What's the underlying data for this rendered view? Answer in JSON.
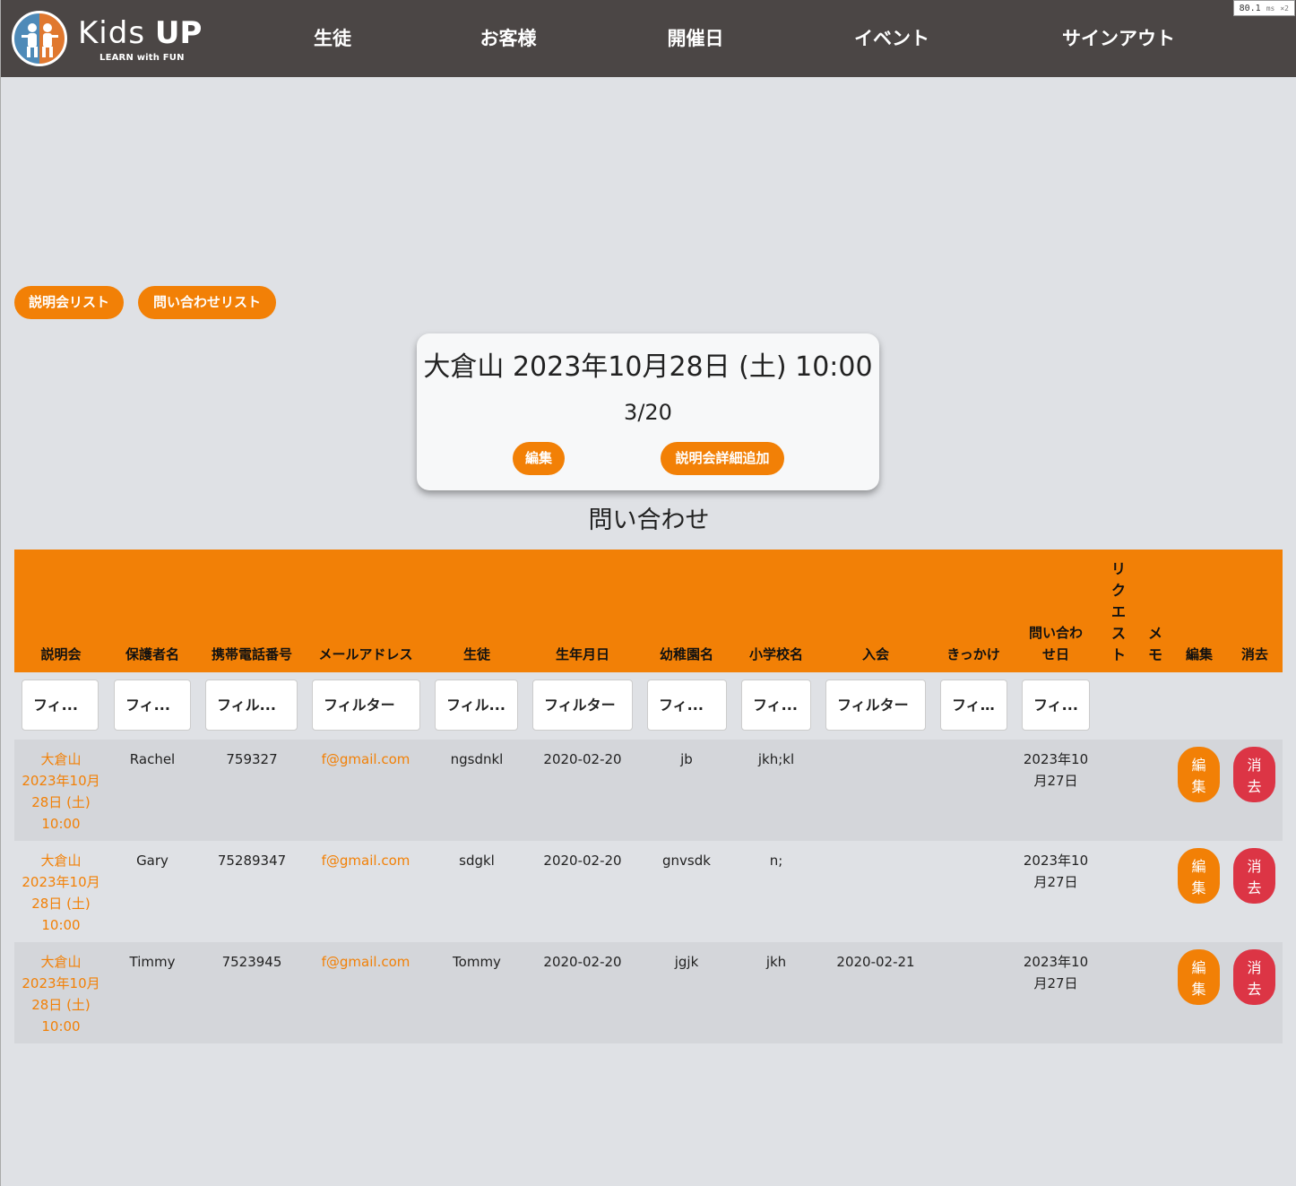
{
  "brand": {
    "name_kids": "Kids",
    "name_up": "UP",
    "tagline": "LEARN with FUN"
  },
  "nav": [
    {
      "label": "生徒"
    },
    {
      "label": "お客様"
    },
    {
      "label": "開催日"
    },
    {
      "label": "イベント"
    },
    {
      "label": "サインアウト"
    }
  ],
  "perf_badge": {
    "value": "80.1",
    "unit": "ms",
    "suffix": "×2"
  },
  "top_buttons": {
    "info_list": "説明会リスト",
    "inquiry_list": "問い合わせリスト"
  },
  "session_card": {
    "title": "大倉山 2023年10月28日 (土) 10:00",
    "count": "3/20",
    "edit_label": "編集",
    "add_detail_label": "説明会詳細追加"
  },
  "section_title": "問い合わせ",
  "table": {
    "headers": {
      "session": "説明会",
      "guardian": "保護者名",
      "phone": "携帯電話番号",
      "email": "メールアドレス",
      "student": "生徒",
      "birthdate": "生年月日",
      "kindergarten": "幼稚園名",
      "school": "小学校名",
      "enroll": "入会",
      "trigger": "きっかけ",
      "inquiry_date_1": "問い合わ",
      "inquiry_date_2": "せ日",
      "request_vertical": [
        "リ",
        "ク",
        "エ",
        "ス",
        "ト"
      ],
      "memo_vertical": [
        "メ",
        "モ"
      ],
      "edit": "編集",
      "delete": "消去"
    },
    "filters": {
      "f1": "フィ...",
      "f2": "フィ...",
      "f3": "フィル...",
      "f4": "フィルター",
      "f5": "フィル...",
      "f6": "フィルター",
      "f7": "フィ...",
      "f8": "フィ...",
      "f9": "フィルター",
      "f10": "フィ...",
      "f11": "フィ..."
    },
    "rows": [
      {
        "session_lines": [
          "大倉山",
          "2023年10月",
          "28日 (土)",
          "10:00"
        ],
        "guardian": "Rachel",
        "phone": "759327",
        "email": "f@gmail.com",
        "student": "ngsdnkl",
        "birthdate": "2020-02-20",
        "kindergarten": "jb",
        "school": "jkh;kl",
        "enroll": "",
        "trigger": "",
        "inquiry_lines": [
          "2023年10",
          "月27日"
        ],
        "edit": [
          "編",
          "集"
        ],
        "delete": [
          "消",
          "去"
        ]
      },
      {
        "session_lines": [
          "大倉山",
          "2023年10月",
          "28日 (土)",
          "10:00"
        ],
        "guardian": "Gary",
        "phone": "75289347",
        "email": "f@gmail.com",
        "student": "sdgkl",
        "birthdate": "2020-02-20",
        "kindergarten": "gnvsdk",
        "school": "n;",
        "enroll": "",
        "trigger": "",
        "inquiry_lines": [
          "2023年10",
          "月27日"
        ],
        "edit": [
          "編",
          "集"
        ],
        "delete": [
          "消",
          "去"
        ]
      },
      {
        "session_lines": [
          "大倉山",
          "2023年10月",
          "28日 (土)",
          "10:00"
        ],
        "guardian": "Timmy",
        "phone": "7523945",
        "email": "f@gmail.com",
        "student": "Tommy",
        "birthdate": "2020-02-20",
        "kindergarten": "jgjk",
        "school": "jkh",
        "enroll": "2020-02-21",
        "trigger": "",
        "inquiry_lines": [
          "2023年10",
          "月27日"
        ],
        "edit": [
          "編",
          "集"
        ],
        "delete": [
          "消",
          "去"
        ]
      }
    ]
  },
  "colors": {
    "header_bg": "#4b4645",
    "page_bg": "#dfe1e5",
    "accent_orange": "#f28006",
    "delete_red": "#dc3545",
    "row_odd": "#d4d6da",
    "row_even": "#dfe1e5"
  }
}
